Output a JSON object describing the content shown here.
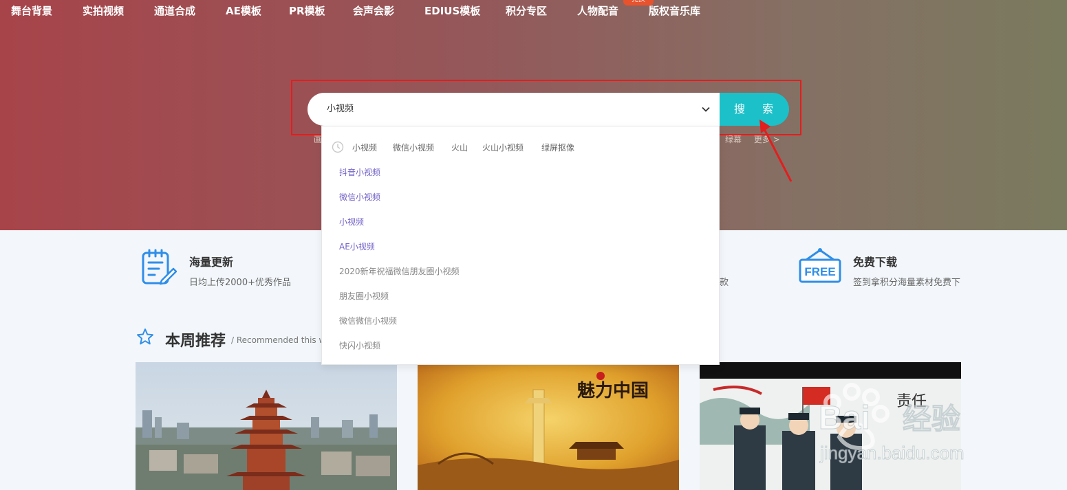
{
  "nav": {
    "items": [
      "舞台背景",
      "实拍视频",
      "通道合成",
      "AE模板",
      "PR模板",
      "会声会影",
      "EDIUS模板",
      "积分专区",
      "人物配音",
      "版权音乐库"
    ],
    "badge": "兑换"
  },
  "search": {
    "value": "小视频",
    "button_label": "搜 索"
  },
  "hot_tags": {
    "left_fragment": "画",
    "right_tags": [
      "绿幕",
      "更多 >"
    ]
  },
  "dropdown": {
    "history": [
      "小视频",
      "微信小视频",
      "火山",
      "火山小视频",
      "绿屏抠像"
    ],
    "suggestions": [
      "抖音小视频",
      "微信小视频",
      "小视频",
      "AE小视频",
      "2020新年祝福微信朋友圈小视频",
      "朋友圈小视频",
      "微信微信小视频",
      "快闪小视频"
    ]
  },
  "features": [
    {
      "title": "海量更新",
      "subtitle": "日均上传2000+优秀作品",
      "icon": "document-edit-icon"
    },
    {
      "title": "",
      "subtitle": "款",
      "icon": ""
    },
    {
      "title": "免费下载",
      "subtitle": "签到拿积分海量素材免费下",
      "icon": "free-sign-icon"
    }
  ],
  "section": {
    "title": "本周推荐",
    "subtitle": "/ Recommended this w"
  },
  "cards": [
    {
      "theme": "yellow-crane-tower-photo"
    },
    {
      "theme": "charm-china-golden-artwork",
      "overlay_text": "魅力中国"
    },
    {
      "theme": "police-salute-illustration",
      "overlay_text": "责任"
    }
  ],
  "watermark": {
    "text": "Baidu经验",
    "url_text": "jingyan.baidu.com"
  },
  "colors": {
    "search_button": "#1cc0c8",
    "highlight_box": "#e41d1d",
    "suggestion_link": "#7162c8",
    "feature_icon": "#2f8ee8"
  }
}
